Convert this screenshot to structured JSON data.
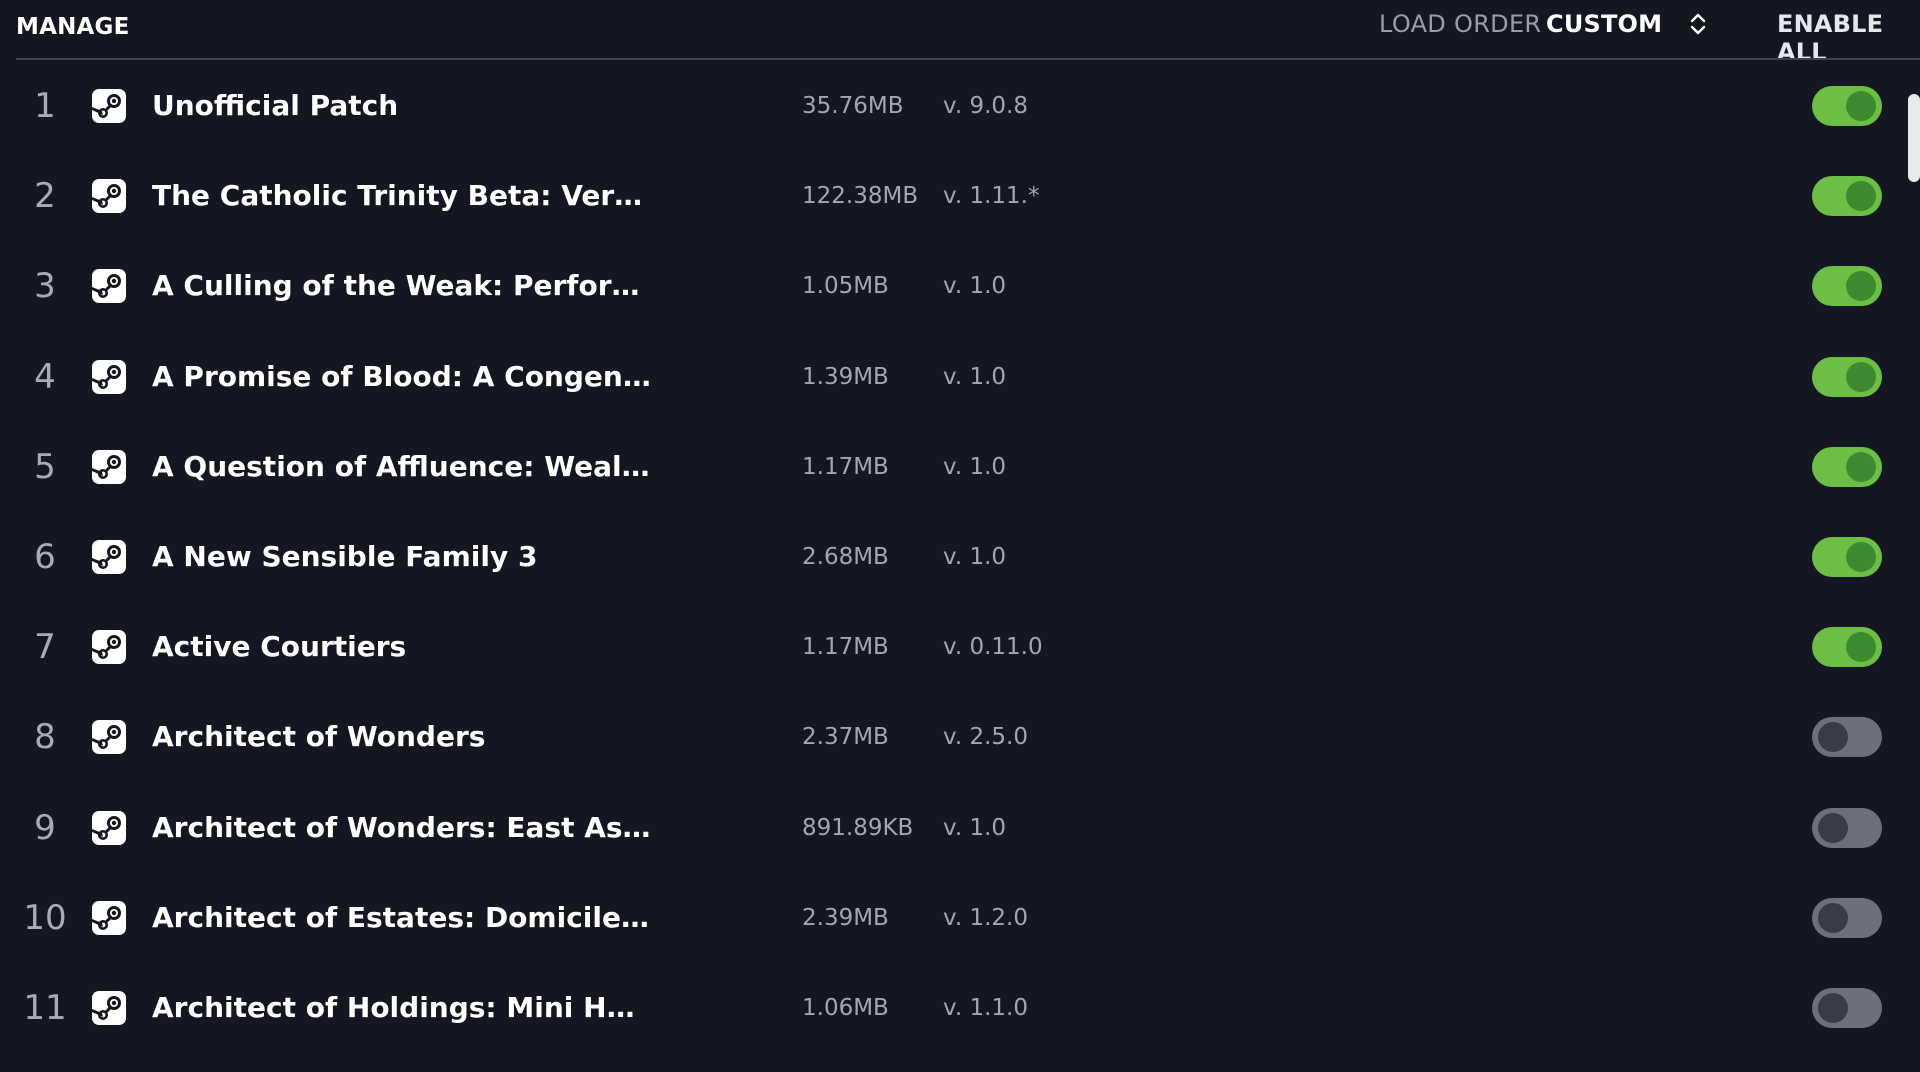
{
  "header": {
    "manage_label": "MANAGE",
    "load_order_label": "LOAD ORDER",
    "sort_value": "CUSTOM",
    "enable_all_label": "ENABLE ALL"
  },
  "colors": {
    "background": "#141622",
    "toggle_on": "#6cbe45",
    "toggle_off": "#6e7079"
  },
  "mods": [
    {
      "index": "1",
      "icon": "steam-icon",
      "name": "Unofficial Patch",
      "size": "35.76MB",
      "version": "v. 9.0.8",
      "enabled": true
    },
    {
      "index": "2",
      "icon": "steam-icon",
      "name": "The Catholic Trinity Beta: Version …",
      "size": "122.38MB",
      "version": "v. 1.11.*",
      "enabled": true
    },
    {
      "index": "3",
      "icon": "steam-icon",
      "name": "A Culling of the Weak: Performanc…",
      "size": "1.05MB",
      "version": "v. 1.0",
      "enabled": true
    },
    {
      "index": "4",
      "icon": "steam-icon",
      "name": "A Promise of Blood: A Congenital …",
      "size": "1.39MB",
      "version": "v. 1.0",
      "enabled": true
    },
    {
      "index": "5",
      "icon": "steam-icon",
      "name": "A Question of Affluence: Wealth Tr…",
      "size": "1.17MB",
      "version": "v. 1.0",
      "enabled": true
    },
    {
      "index": "6",
      "icon": "steam-icon",
      "name": "A New Sensible Family 3",
      "size": "2.68MB",
      "version": "v. 1.0",
      "enabled": true
    },
    {
      "index": "7",
      "icon": "steam-icon",
      "name": "Active Courtiers",
      "size": "1.17MB",
      "version": "v. 0.11.0",
      "enabled": true
    },
    {
      "index": "8",
      "icon": "steam-icon",
      "name": "Architect of Wonders",
      "size": "2.37MB",
      "version": "v. 2.5.0",
      "enabled": false
    },
    {
      "index": "9",
      "icon": "steam-icon",
      "name": "Architect of Wonders: East Asian S…",
      "size": "891.89KB",
      "version": "v. 1.0",
      "enabled": false
    },
    {
      "index": "10",
      "icon": "steam-icon",
      "name": "Architect of Estates: Domiciles Bui…",
      "size": "2.39MB",
      "version": "v. 1.2.0",
      "enabled": false
    },
    {
      "index": "11",
      "icon": "steam-icon",
      "name": "Architect of Holdings: Mini Holdin…",
      "size": "1.06MB",
      "version": "v. 1.1.0",
      "enabled": false
    }
  ]
}
